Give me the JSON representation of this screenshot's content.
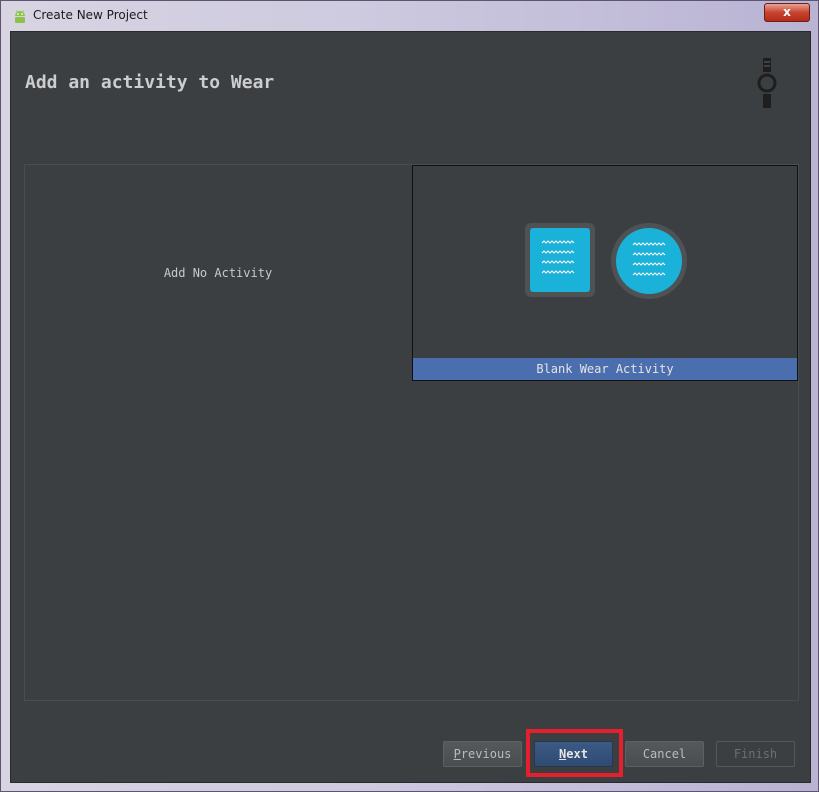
{
  "window": {
    "title": "Create New Project",
    "close_label": "x"
  },
  "page": {
    "title": "Add an activity to Wear"
  },
  "gallery": {
    "tiles": [
      {
        "label": "Add No Activity",
        "selected": false
      },
      {
        "label": "Blank Wear Activity",
        "selected": true
      }
    ]
  },
  "buttons": {
    "previous": {
      "mnemonic": "P",
      "rest": "revious",
      "enabled": true
    },
    "next": {
      "mnemonic": "N",
      "rest": "ext",
      "enabled": true,
      "highlighted": true
    },
    "cancel": {
      "label": "Cancel",
      "enabled": true
    },
    "finish": {
      "label": "Finish",
      "enabled": false
    }
  },
  "icons": {
    "app": "android-icon",
    "form_factor": "wear-watch-icon",
    "preview": "wear-square-and-round-preview-icon"
  },
  "colors": {
    "background": "#3c3f41",
    "selection": "#4b6eaf",
    "highlight": "#e3202b",
    "preview_fill": "#1ab2d9"
  }
}
